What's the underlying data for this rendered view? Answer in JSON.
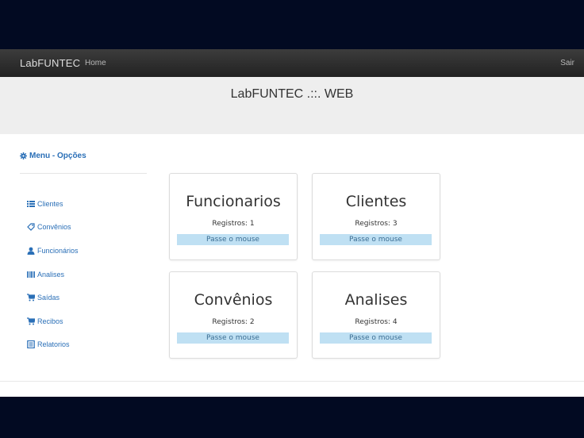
{
  "navbar": {
    "brand": "LabFUNTEC",
    "home_label": "Home",
    "exit_label": "Sair"
  },
  "hero": {
    "title": "LabFUNTEC .::. WEB"
  },
  "sidebar": {
    "title": "Menu - Opções",
    "title_icon": "gear-icon",
    "items": [
      {
        "label": "Clientes",
        "icon": "list-icon"
      },
      {
        "label": "Convênios",
        "icon": "tag-icon"
      },
      {
        "label": "Funcionários",
        "icon": "user-icon"
      },
      {
        "label": "Analises",
        "icon": "barcode-icon"
      },
      {
        "label": "Saídas",
        "icon": "cart-icon"
      },
      {
        "label": "Recibos",
        "icon": "cart-icon"
      },
      {
        "label": "Relatorios",
        "icon": "document-icon"
      }
    ]
  },
  "cards": [
    {
      "title": "Funcionarios",
      "count": "Registros: 1",
      "hover": "Passe o mouse"
    },
    {
      "title": "Clientes",
      "count": "Registros: 3",
      "hover": "Passe o mouse"
    },
    {
      "title": "Convênios",
      "count": "Registros: 2",
      "hover": "Passe o mouse"
    },
    {
      "title": "Analises",
      "count": "Registros: 4",
      "hover": "Passe o mouse"
    }
  ],
  "colors": {
    "link": "#2a6fb7",
    "navbar": "#2b2b2b",
    "hero": "#eeeeee",
    "hover_bar": "#bfe0f3",
    "backdrop": "#020a22"
  }
}
